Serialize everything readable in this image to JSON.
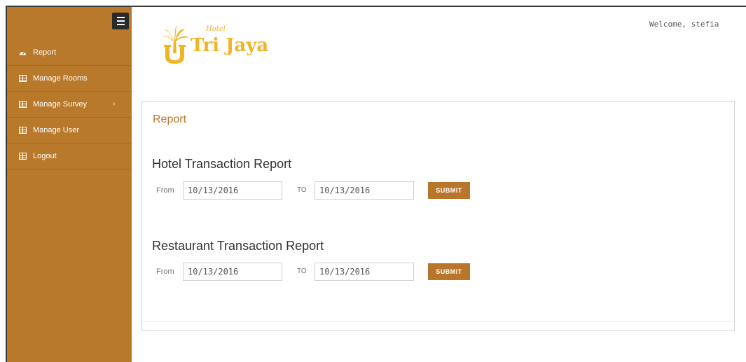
{
  "header": {
    "welcome_text": "Welcome, stefia",
    "logo": {
      "small_text": "Hotel",
      "main_text": "Tri Jaya"
    }
  },
  "sidebar": {
    "items": [
      {
        "label": "Report",
        "icon": "dashboard-icon"
      },
      {
        "label": "Manage Rooms",
        "icon": "table-icon"
      },
      {
        "label": "Manage Survey",
        "icon": "table-icon",
        "has_submenu": true
      },
      {
        "label": "Manage User",
        "icon": "table-icon"
      },
      {
        "label": "Logout",
        "icon": "table-icon"
      }
    ]
  },
  "main": {
    "title": "Report",
    "sections": [
      {
        "title": "Hotel Transaction Report",
        "from_label": "From",
        "from_value": "10/13/2016",
        "to_label": "TO",
        "to_value": "10/13/2016",
        "submit_label": "SUBMIT"
      },
      {
        "title": "Restaurant Transaction Report",
        "from_label": "From",
        "from_value": "10/13/2016",
        "to_label": "TO",
        "to_value": "10/13/2016",
        "submit_label": "SUBMIT"
      }
    ]
  },
  "colors": {
    "sidebar_bg": "#b9792a",
    "accent": "#b8762a",
    "logo": "#f0b429"
  }
}
